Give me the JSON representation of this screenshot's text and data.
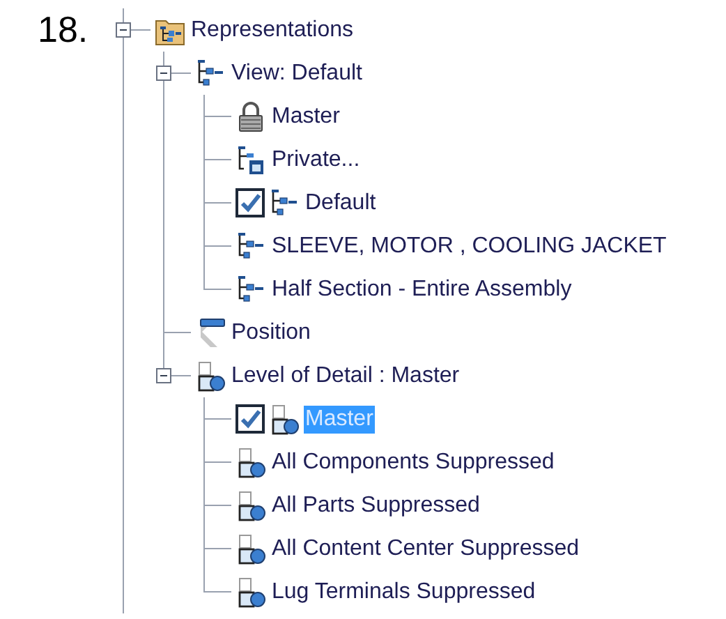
{
  "step": "18.",
  "tree": [
    {
      "label": "Representations",
      "kind": "folder",
      "selected": false,
      "expanded": true,
      "children": [
        {
          "label": "View: Default",
          "kind": "view",
          "selected": false,
          "expanded": true,
          "children": [
            {
              "label": "Master",
              "kind": "lock",
              "selected": false
            },
            {
              "label": "Private...",
              "kind": "private",
              "selected": false
            },
            {
              "label": "Default",
              "kind": "view",
              "selected": false,
              "checked": true
            },
            {
              "label": "SLEEVE, MOTOR , COOLING JACKET",
              "kind": "view",
              "selected": false
            },
            {
              "label": "Half Section - Entire Assembly",
              "kind": "view",
              "selected": false
            }
          ]
        },
        {
          "label": "Position",
          "kind": "position",
          "selected": false
        },
        {
          "label": "Level of Detail : Master",
          "kind": "lod",
          "selected": false,
          "expanded": true,
          "children": [
            {
              "label": "Master",
              "kind": "lod",
              "selected": true,
              "checked": true
            },
            {
              "label": "All Components Suppressed",
              "kind": "lod",
              "selected": false
            },
            {
              "label": "All Parts Suppressed",
              "kind": "lod",
              "selected": false
            },
            {
              "label": "All Content Center Suppressed",
              "kind": "lod",
              "selected": false
            },
            {
              "label": "Lug Terminals Suppressed",
              "kind": "lod",
              "selected": false
            }
          ]
        }
      ]
    }
  ]
}
